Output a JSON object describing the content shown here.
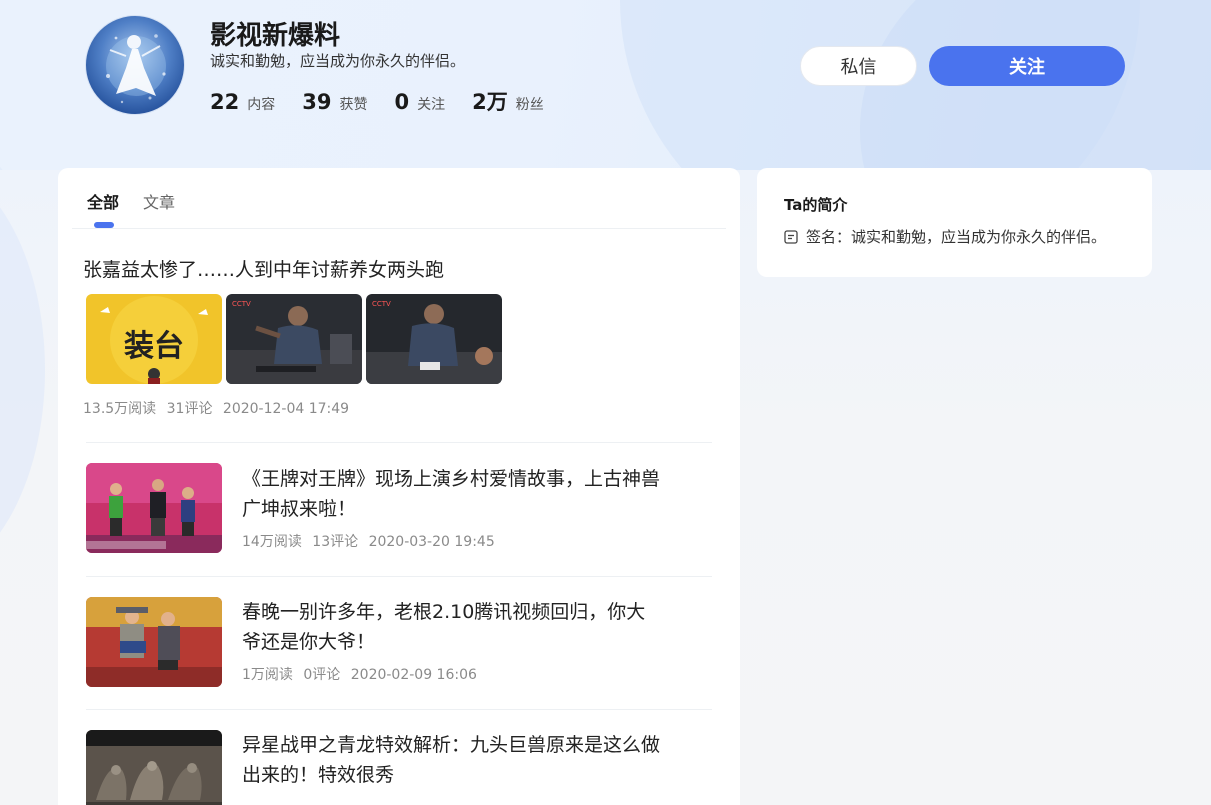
{
  "profile": {
    "name": "影视新爆料",
    "signature": "诚实和勤勉，应当成为你永久的伴侣。",
    "stats": [
      {
        "num": "22",
        "label": "内容"
      },
      {
        "num": "39",
        "label": "获赞"
      },
      {
        "num": "0",
        "label": "关注"
      },
      {
        "num": "2万",
        "label": "粉丝"
      }
    ],
    "message_label": "私信",
    "follow_label": "关注",
    "avatar_icon": "avatar-girl-illustration"
  },
  "tabs": [
    {
      "label": "全部",
      "active": true
    },
    {
      "label": "文章",
      "active": false
    }
  ],
  "articles": [
    {
      "title": "张嘉益太惨了……人到中年讨薪养女两头跑",
      "reads": "13.5万阅读",
      "comments": "31评论",
      "date": "2020-12-04 17:49"
    },
    {
      "title": "《王牌对王牌》现场上演乡村爱情故事，上古神兽广坤叔来啦！",
      "reads": "14万阅读",
      "comments": "13评论",
      "date": "2020-03-20 19:45"
    },
    {
      "title": "春晚一别许多年，老根2.10腾讯视频回归，你大爷还是你大爷！",
      "reads": "1万阅读",
      "comments": "0评论",
      "date": "2020-02-09 16:06"
    },
    {
      "title": "异星战甲之青龙特效解析：九头巨兽原来是这么做出来的！特效很秀",
      "reads": "",
      "comments": "",
      "date": ""
    }
  ],
  "intro": {
    "title": "Ta的简介",
    "signature_label": "签名：",
    "signature": "诚实和勤勉，应当成为你永久的伴侣。"
  },
  "colors": {
    "accent": "#4a73ee",
    "card": "#ffffff",
    "background": "#f4f5f7"
  }
}
